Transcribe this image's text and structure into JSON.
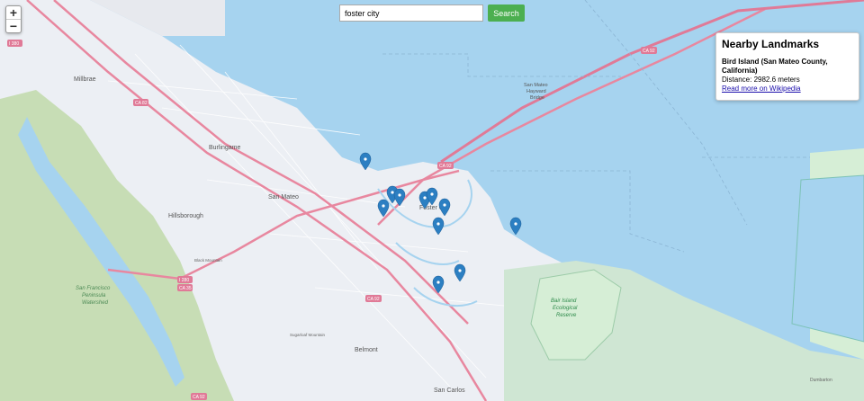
{
  "search": {
    "value": "foster city",
    "button": "Search"
  },
  "zoom": {
    "in": "+",
    "out": "−"
  },
  "panel": {
    "title": "Nearby Landmarks",
    "landmark_name": "Bird Island (San Mateo County, California)",
    "distance": "Distance: 2982.6 meters",
    "link": "Read more on Wikipedia"
  },
  "map_labels": {
    "millbrae": "Millbrae",
    "burlingame": "Burlingame",
    "san_mateo": "San Mateo",
    "hillsborough": "Hillsborough",
    "foster_city": "Foster City",
    "belmont": "Belmont",
    "san_carlos": "San Carlos",
    "bridge1": "San Mateo",
    "bridge2": "Hayward",
    "bridge3": "Bridge",
    "watershed1": "San Francisco",
    "watershed2": "Peninsula",
    "watershed3": "Watershed",
    "reserve1": "Bair Island",
    "reserve2": "Ecological",
    "reserve3": "Reserve",
    "ca92_1": "CA 92",
    "ca92_2": "CA 92",
    "ca92_3": "CA 92",
    "ca92_4": "CA 92",
    "i280": "I 280",
    "ca35": "CA 35",
    "i380": "I 380",
    "ca82": "CA 82",
    "black_mountain": "Black Mountain",
    "sugarloaf": "Sugarloaf Mountain",
    "dumbarton": "Dumbarton"
  },
  "colors": {
    "water": "#a6d3ef",
    "land": "#eef0f4",
    "green": "#c8dfb5",
    "highway": "#e8879f",
    "marker": "#2c7fc2"
  },
  "marker_count": 12
}
